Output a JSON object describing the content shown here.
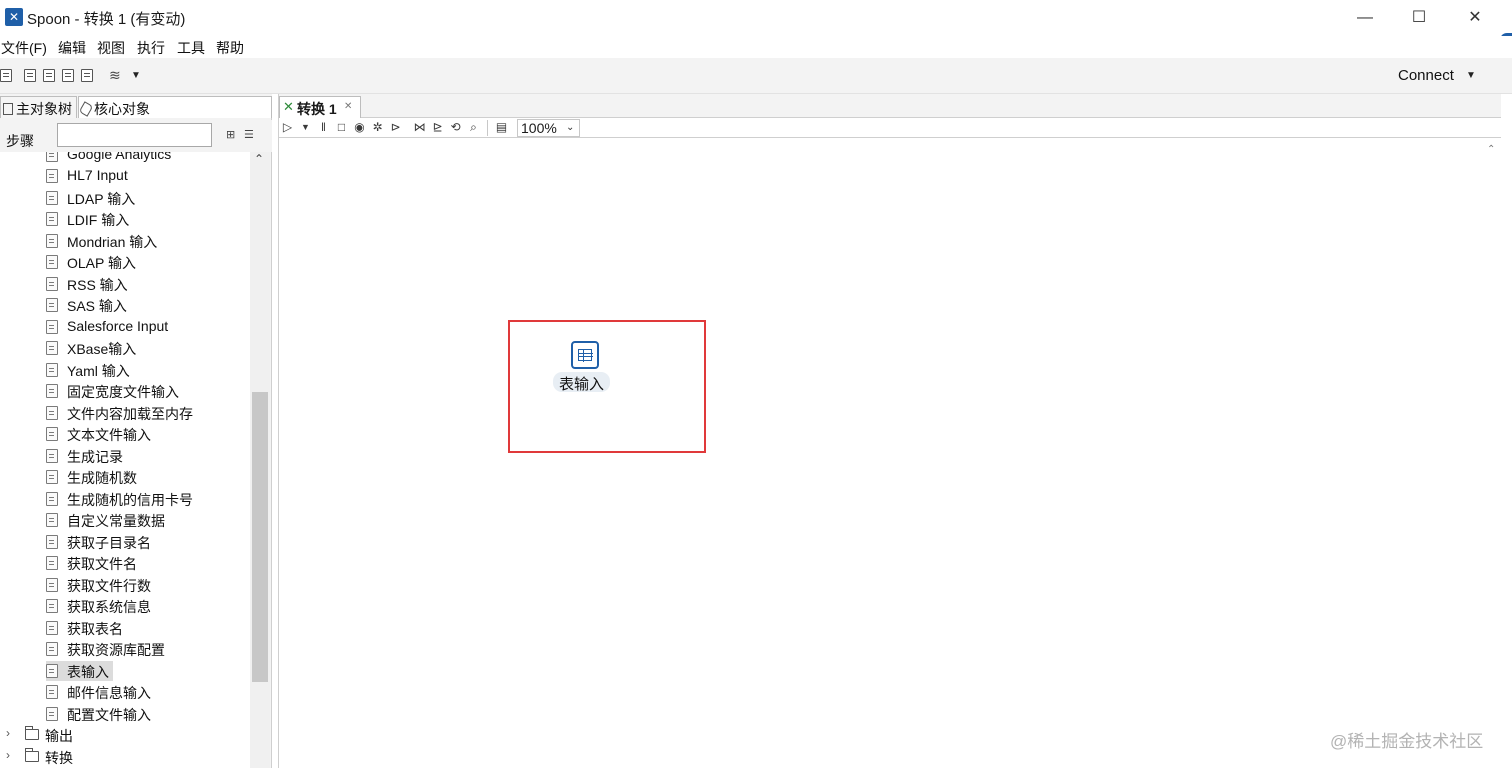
{
  "window": {
    "title": "Spoon - 转换 1 (有变动)",
    "app_icon": "spoon-logo-icon"
  },
  "menu": {
    "items": [
      "文件(F)",
      "编辑",
      "视图",
      "执行",
      "工具",
      "帮助"
    ]
  },
  "toolbar": {
    "connect_label": "Connect"
  },
  "left_panel": {
    "tabs": [
      "主对象树",
      "核心对象"
    ],
    "steps_label": "步骤",
    "search_value": "",
    "tree_items": [
      "Google Analytics",
      "HL7 Input",
      "LDAP 输入",
      "LDIF 输入",
      "Mondrian 输入",
      "OLAP 输入",
      "RSS 输入",
      "SAS 输入",
      "Salesforce Input",
      "XBase输入",
      "Yaml 输入",
      "固定宽度文件输入",
      "文件内容加载至内存",
      "文本文件输入",
      "生成记录",
      "生成随机数",
      "生成随机的信用卡号",
      "自定义常量数据",
      "获取子目录名",
      "获取文件名",
      "获取文件行数",
      "获取系统信息",
      "获取表名",
      "获取资源库配置",
      "表输入",
      "邮件信息输入",
      "配置文件输入"
    ],
    "selected_item": "表输入",
    "folders": [
      "输出",
      "转换"
    ]
  },
  "editor": {
    "tab_label": "转换 1",
    "zoom": "100%",
    "step_node_label": "表输入"
  },
  "watermark": "@稀土掘金技术社区",
  "colors": {
    "accent": "#1f5fa8",
    "highlight": "#e0393a",
    "selection": "#dcdcdc"
  }
}
